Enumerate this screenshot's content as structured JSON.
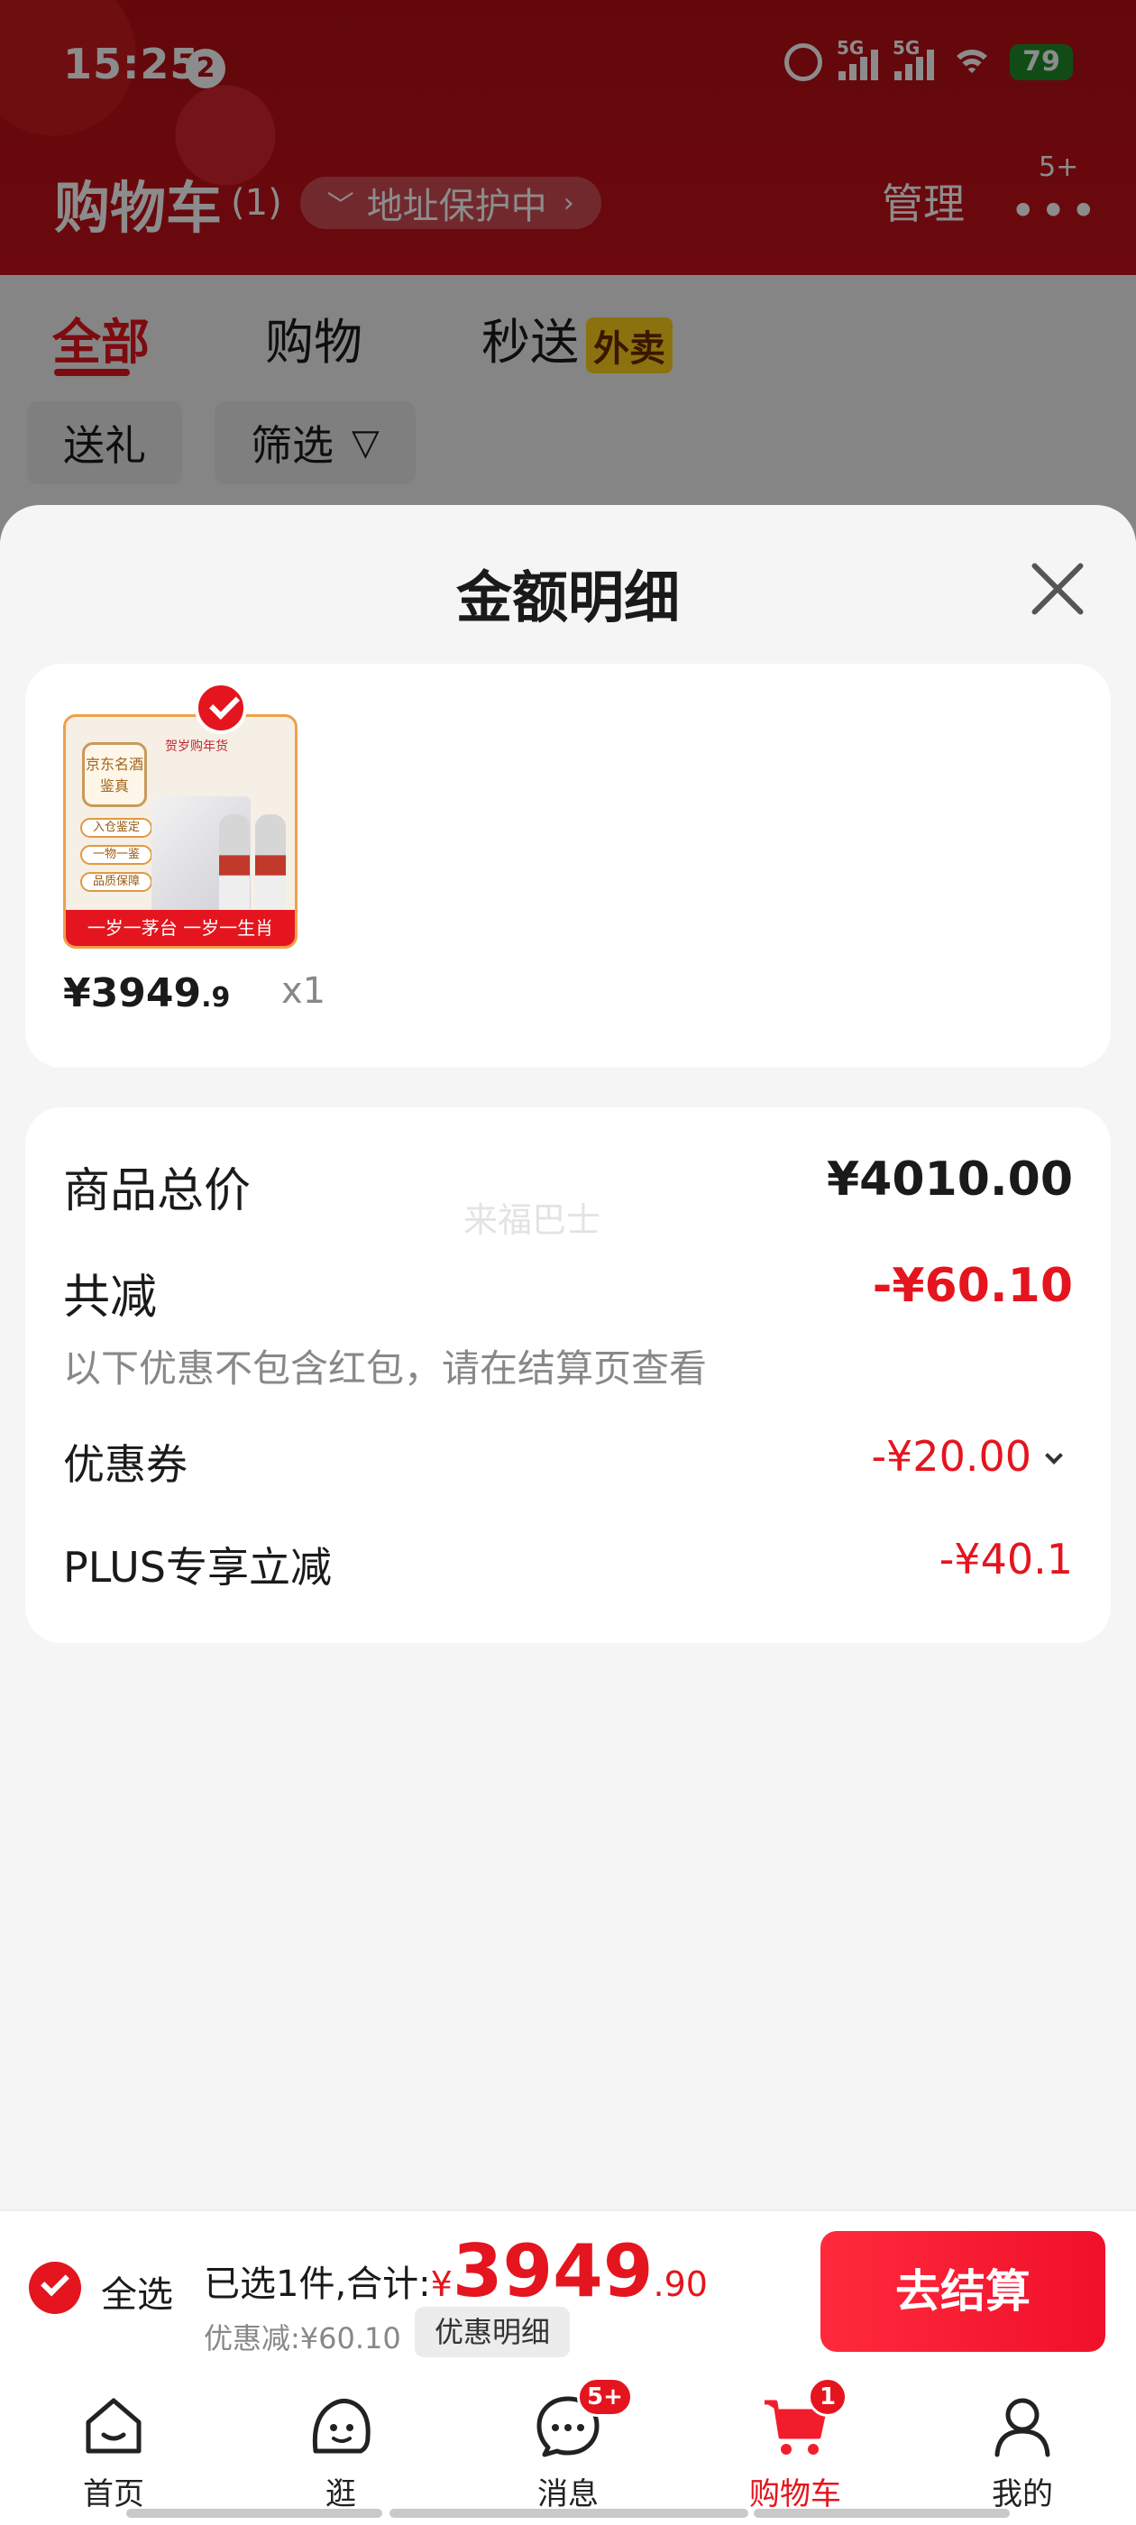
{
  "status_bar": {
    "time": "15:25",
    "notif_count": "2",
    "signal1": "5G",
    "signal2": "5G",
    "battery": "79"
  },
  "header": {
    "title": "购物车",
    "count": "(1)",
    "address_protect": "地址保护中",
    "manage": "管理",
    "more_badge": "5+"
  },
  "tabs": [
    {
      "label": "全部",
      "active": true
    },
    {
      "label": "购物",
      "active": false
    },
    {
      "label": "秒送",
      "tag": "外卖",
      "active": false
    }
  ],
  "filters": [
    {
      "label": "送礼"
    },
    {
      "label": "筛选"
    }
  ],
  "sheet": {
    "title": "金额明细",
    "product": {
      "price_main": "¥3949",
      "price_decimal": ".9",
      "qty": "x1",
      "image_band": "一岁一茅台 一岁一生肖",
      "image_badge": "京东名酒鉴真",
      "image_tags": [
        "入仓鉴定",
        "一物一鉴",
        "品质保障"
      ],
      "image_header": "贺岁购年货"
    },
    "detail": {
      "total_label": "商品总价",
      "total_value": "¥4010.00",
      "watermark": "来福巴士",
      "reduce_label": "共减",
      "reduce_value": "-¥60.10",
      "reduce_note": "以下优惠不包含红包，请在结算页查看",
      "coupon_label": "优惠券",
      "coupon_value": "-¥20.00",
      "plus_label": "PLUS专享立减",
      "plus_value": "-¥40.1"
    }
  },
  "checkout": {
    "select_all": "全选",
    "summary_prefix": "已选1件,合计:",
    "currency": "¥",
    "amount_int": "3949",
    "amount_dec": ".90",
    "discount_text": "优惠减:¥60.10",
    "discount_detail_btn": "优惠明细",
    "checkout_btn": "去结算"
  },
  "tabbar": [
    {
      "label": "首页",
      "icon": "home-icon"
    },
    {
      "label": "逛",
      "icon": "browse-icon"
    },
    {
      "label": "消息",
      "icon": "message-icon",
      "badge": "5+"
    },
    {
      "label": "购物车",
      "icon": "cart-icon",
      "badge": "1",
      "active": true
    },
    {
      "label": "我的",
      "icon": "profile-icon"
    }
  ],
  "colors": {
    "brand_red": "#e4151e",
    "header_red": "#b40e14",
    "battery_green": "#1f8a2a"
  }
}
